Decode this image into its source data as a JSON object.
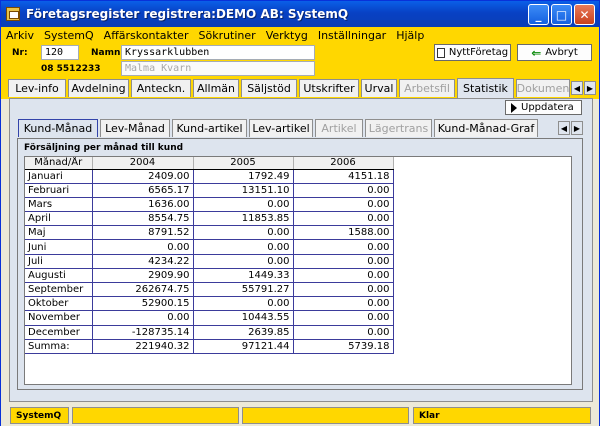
{
  "window": {
    "title": "Företagsregister registrera:DEMO AB: SystemQ"
  },
  "menu": [
    "Arkiv",
    "SystemQ",
    "Affärskontakter",
    "Sökrutiner",
    "Verktyg",
    "Inställningar",
    "Hjälp"
  ],
  "header": {
    "nr_label": "Nr:",
    "nr_value": "120",
    "phone": "08 5512233",
    "namn_label": "Namn:",
    "namn_value": "Kryssarklubben",
    "namn2_value": "Malma Kvarn",
    "new_company_label": "NyttFöretag",
    "cancel_label": "Avbryt"
  },
  "main_tabs": [
    "Lev-info",
    "Avdelning",
    "Anteckn.",
    "Allmän",
    "Säljstöd",
    "Utskrifter",
    "Urval",
    "Arbetsfil",
    "Statistik",
    "Dokumen"
  ],
  "update_label": "Uppdatera",
  "sub_tabs": [
    "Kund-Månad",
    "Lev-Månad",
    "Kund-artikel",
    "Lev-artikel",
    "Artikel",
    "Lägertrans",
    "Kund-Månad-Graf"
  ],
  "grid": {
    "title": "Försäljning per månad till kund",
    "columns": [
      "Månad/År",
      "2004",
      "2005",
      "2006"
    ],
    "rows": [
      [
        "Januari",
        "2409.00",
        "1792.49",
        "4151.18"
      ],
      [
        "Februari",
        "6565.17",
        "13151.10",
        "0.00"
      ],
      [
        "Mars",
        "1636.00",
        "0.00",
        "0.00"
      ],
      [
        "April",
        "8554.75",
        "11853.85",
        "0.00"
      ],
      [
        "Maj",
        "8791.52",
        "0.00",
        "1588.00"
      ],
      [
        "Juni",
        "0.00",
        "0.00",
        "0.00"
      ],
      [
        "Juli",
        "4234.22",
        "0.00",
        "0.00"
      ],
      [
        "Augusti",
        "2909.90",
        "1449.33",
        "0.00"
      ],
      [
        "September",
        "262674.75",
        "55791.27",
        "0.00"
      ],
      [
        "Oktober",
        "52900.15",
        "0.00",
        "0.00"
      ],
      [
        "November",
        "0.00",
        "10443.55",
        "0.00"
      ],
      [
        "December",
        "-128735.14",
        "2639.85",
        "0.00"
      ],
      [
        "Summa:",
        "221940.32",
        "97121.44",
        "5739.18"
      ]
    ]
  },
  "status": {
    "left": "SystemQ",
    "right": "Klar"
  }
}
